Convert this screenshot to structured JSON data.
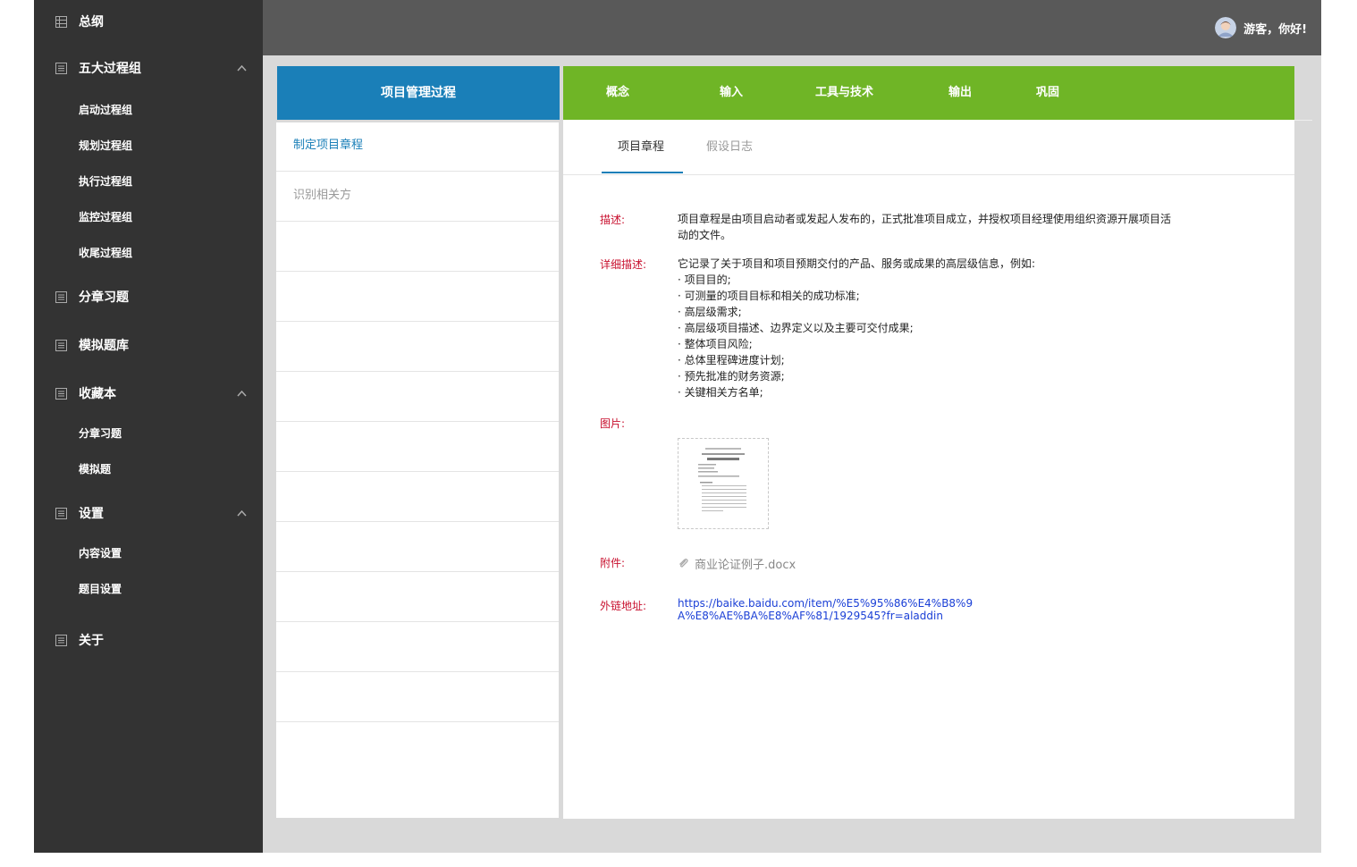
{
  "sidebar": {
    "groups": [
      {
        "label": "总纲"
      },
      {
        "label": "五大过程组",
        "sub": [
          "启动过程组",
          "规划过程组",
          "执行过程组",
          "监控过程组",
          "收尾过程组"
        ]
      },
      {
        "label": "分章习题"
      },
      {
        "label": "模拟题库"
      },
      {
        "label": "收藏本",
        "sub": [
          "分章习题",
          "模拟题"
        ]
      },
      {
        "label": "设置",
        "sub": [
          "内容设置",
          "题目设置"
        ]
      },
      {
        "label": "关于"
      }
    ]
  },
  "header": {
    "greeting": "游客，你好!"
  },
  "left_panel": {
    "title": "项目管理过程",
    "items": [
      "制定项目章程",
      "识别相关方"
    ]
  },
  "right_panel": {
    "tabs": [
      "概念",
      "输入",
      "工具与技术",
      "输出",
      "巩固"
    ],
    "subtabs": [
      "项目章程",
      "假设日志"
    ],
    "description_label": "描述:",
    "description": "项目章程是由项目启动者或发起人发布的，正式批准项目成立，并授权项目经理使用组织资源开展项目活动的文件。",
    "detail_label": "详细描述:",
    "detail_intro": "它记录了关于项目和项目预期交付的产品、服务或成果的高层级信息，例如:",
    "detail_items": [
      "· 项目目的;",
      "·  可测量的项目目标和相关的成功标准;",
      "·  高层级需求;",
      "·  高层级项目描述、边界定义以及主要可交付成果;",
      "·  整体项目风险;",
      "·  总体里程碑进度计划;",
      "·  预先批准的财务资源;",
      "·  关键相关方名单;"
    ],
    "image_label": "图片:",
    "attachment_label": "附件:",
    "attachment_name": "商业论证例子.docx",
    "link_label": "外链地址:",
    "link_url": "https://baike.baidu.com/item/%E5%95%86%E4%B8%9A%E8%AE%BA%E8%AF%81/1929545?fr=aladdin"
  },
  "colors": {
    "sidebar_bg": "#333333",
    "header_bg": "#595959",
    "left_header": "#1a7fb8",
    "right_header": "#6fb526",
    "label_red": "#c8102e",
    "active_blue": "#1a7fb8"
  }
}
